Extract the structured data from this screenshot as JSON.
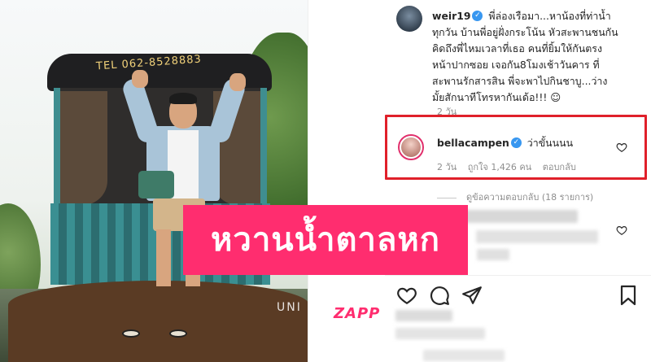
{
  "photo": {
    "boat_sign": "TEL 062-8528883",
    "watermark": "UNI"
  },
  "post": {
    "author": "weir19",
    "caption": "พี่ล่องเรือมา...หาน้องที่ท่าน้ำทุกวัน บ้านพี่อยู่ฝั่งกระโน้น หัวสะพานชนกัน คิดถึงพี่ไหมเวลาที่เธอ คนที่ยิ้มให้กันตรงหน้าปากซอย เจอกัน8โมงเช้าวันคาร ที่สะพานรักสารสิน พี่จะพาไปกินชาบู...ว่างมั้ยสักนาทีโทรหากันเด้อ!!! ☺",
    "age": "2 วัน"
  },
  "comment": {
    "author": "bellacampen",
    "text": "ว่าขั้นนนน",
    "age": "2 วัน",
    "likes": "ถูกใจ 1,426 คน",
    "reply_label": "ตอบกลับ"
  },
  "replies_toggle": "ดูข้อความตอบกลับ (18 รายการ)",
  "headline": "หวานน้ำตาลหก",
  "brand": "ZAPP",
  "colors": {
    "accent": "#ff2d6f",
    "highlight_border": "#e0202a",
    "verified": "#3897f0"
  },
  "icons": [
    "heart-icon",
    "comment-icon",
    "share-icon",
    "bookmark-icon",
    "verified-icon"
  ]
}
